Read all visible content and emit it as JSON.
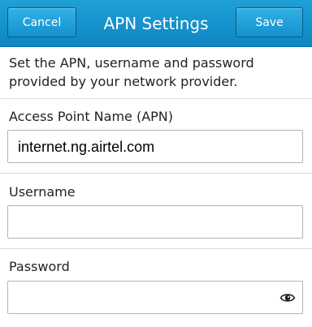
{
  "header": {
    "title": "APN Settings",
    "cancel_label": "Cancel",
    "save_label": "Save"
  },
  "description": "Set the APN, username and password provided by your network provider.",
  "fields": {
    "apn": {
      "label": "Access Point Name (APN)",
      "value": "internet.ng.airtel.com"
    },
    "username": {
      "label": "Username",
      "value": ""
    },
    "password": {
      "label": "Password",
      "value": "",
      "icon": "eye-icon"
    }
  },
  "colors": {
    "titlebar": "#1591cc",
    "text": "#222222"
  }
}
